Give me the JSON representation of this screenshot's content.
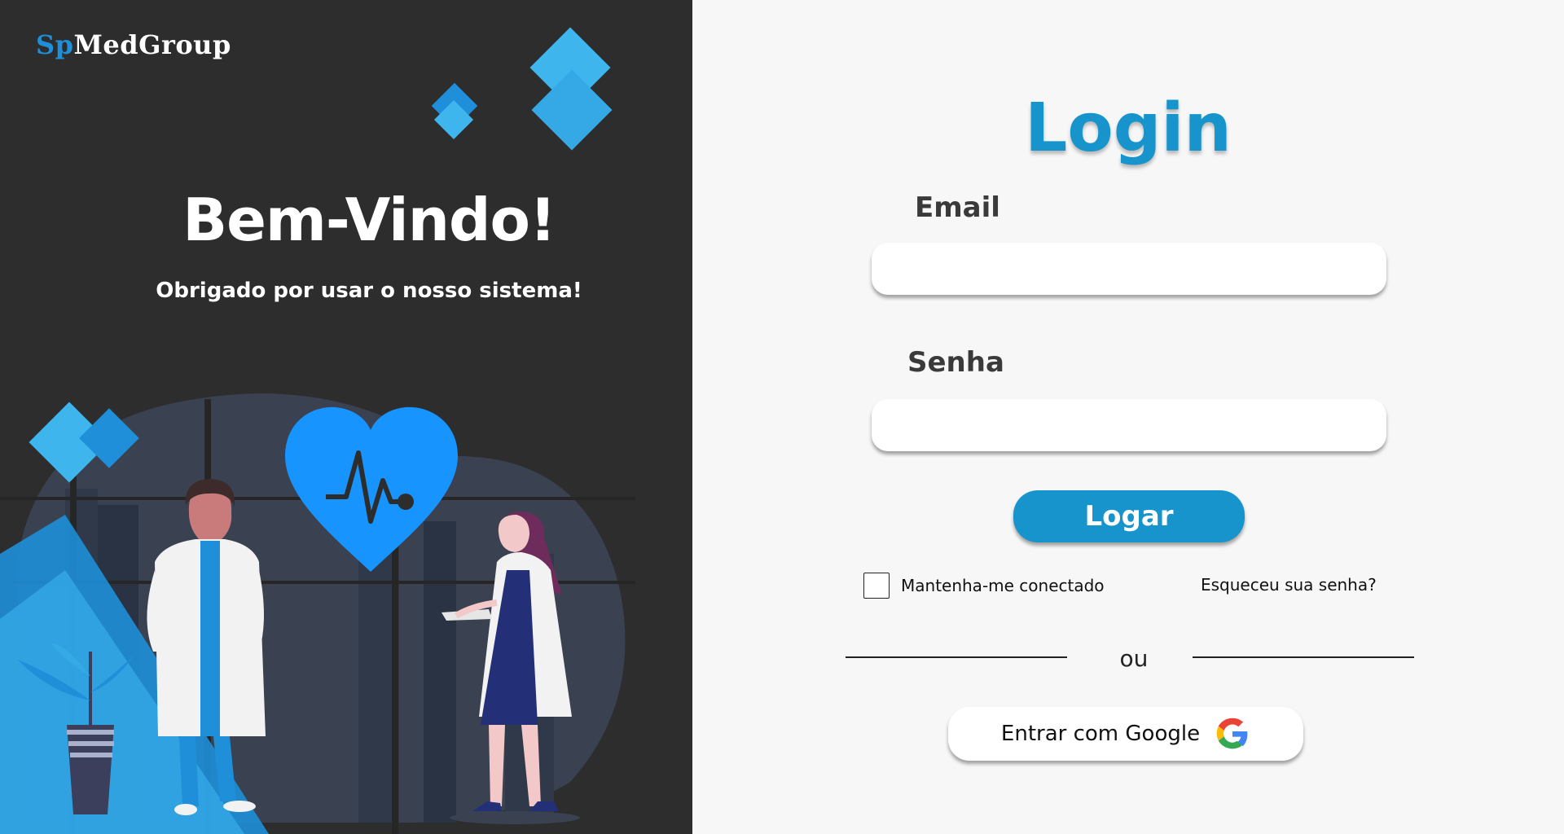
{
  "brand": {
    "prefix": "Sp",
    "name": "MedGroup"
  },
  "welcome": {
    "title": "Bem-Vindo!",
    "subtitle": "Obrigado por usar o nosso sistema!"
  },
  "login": {
    "title": "Login",
    "email_label": "Email",
    "email_value": "",
    "password_label": "Senha",
    "password_value": "",
    "submit_label": "Logar",
    "remember_label": "Mantenha-me conectado",
    "remember_checked": false,
    "forgot_label": "Esqueceu sua senha?",
    "or_label": "ou",
    "google_label": "Entrar com Google"
  },
  "colors": {
    "accent": "#1894cc",
    "brand_blue": "#1e8fd8",
    "left_bg": "#2d2d2d",
    "right_bg": "#f7f7f7"
  },
  "icons": {
    "google": "google-icon",
    "heart": "heart-pulse-icon"
  }
}
